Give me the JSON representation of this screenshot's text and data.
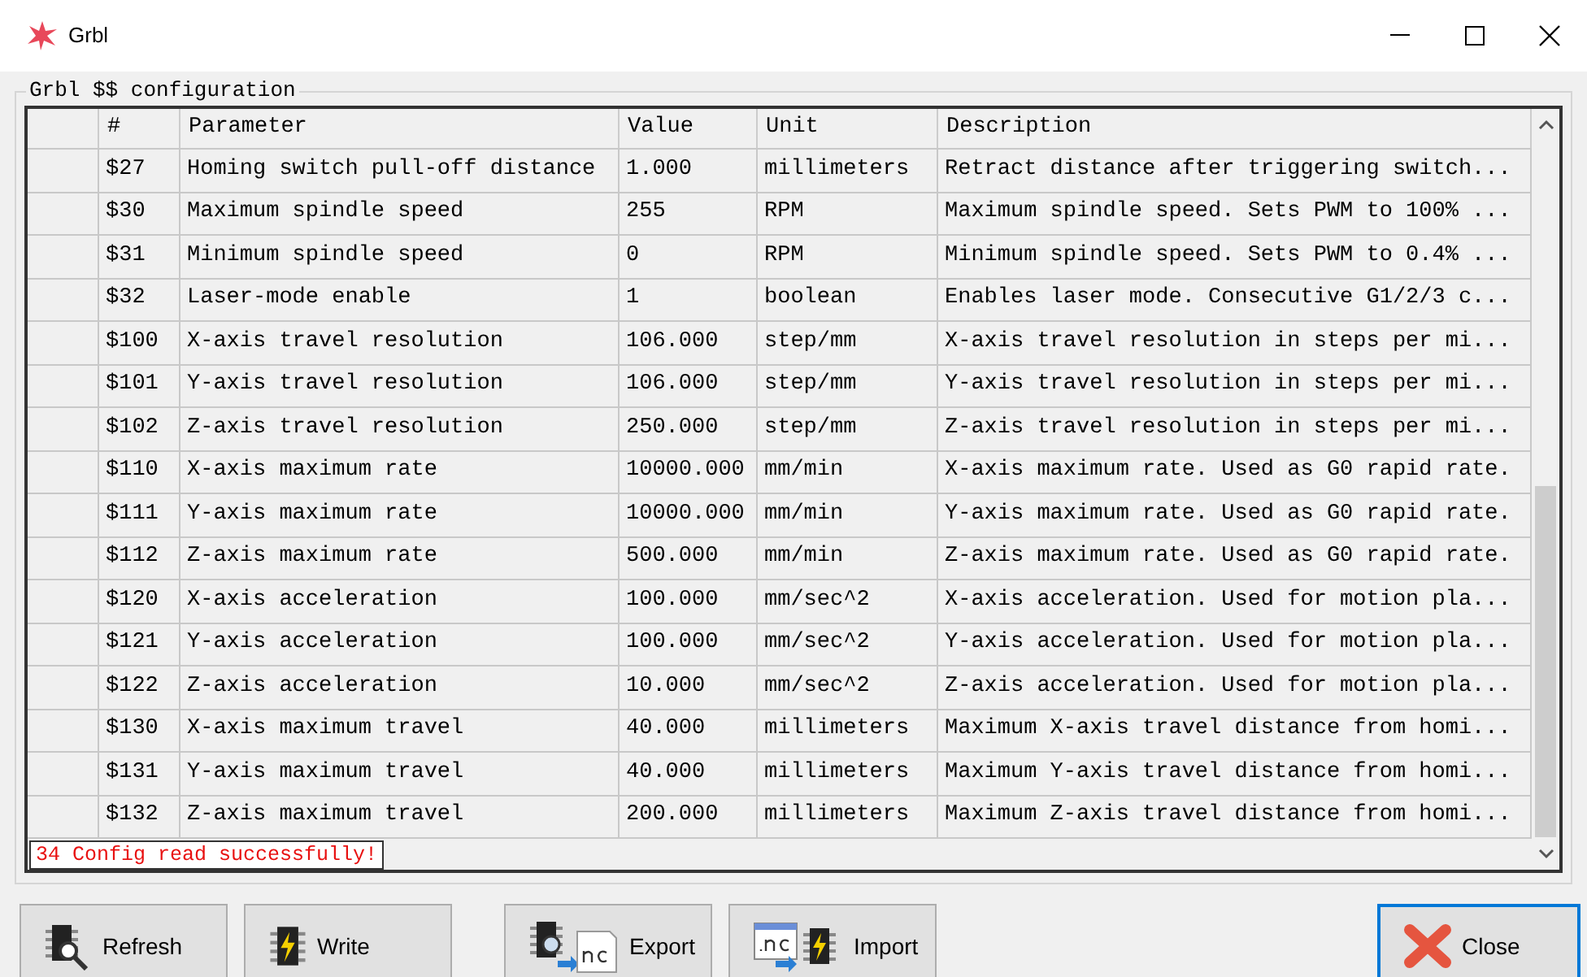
{
  "window": {
    "title": "Grbl"
  },
  "group": {
    "title": "Grbl $$ configuration"
  },
  "table": {
    "columns": [
      "#",
      "Parameter",
      "Value",
      "Unit",
      "Description"
    ],
    "rows": [
      {
        "cells": [
          "$27",
          "Homing switch pull-off distance",
          "1.000",
          "millimeters",
          "Retract distance after triggering switch..."
        ]
      },
      {
        "cells": [
          "$30",
          "Maximum spindle speed",
          "255",
          "RPM",
          "Maximum spindle speed. Sets PWM to 100% ..."
        ]
      },
      {
        "cells": [
          "$31",
          "Minimum spindle speed",
          "0",
          "RPM",
          "Minimum spindle speed. Sets PWM to 0.4% ..."
        ]
      },
      {
        "cells": [
          "$32",
          "Laser-mode enable",
          "1",
          "boolean",
          "Enables laser mode. Consecutive G1/2/3 c..."
        ]
      },
      {
        "cells": [
          "$100",
          "X-axis travel resolution",
          "106.000",
          "step/mm",
          "X-axis travel resolution in steps per mi..."
        ]
      },
      {
        "cells": [
          "$101",
          "Y-axis travel resolution",
          "106.000",
          "step/mm",
          "Y-axis travel resolution in steps per mi..."
        ]
      },
      {
        "cells": [
          "$102",
          "Z-axis travel resolution",
          "250.000",
          "step/mm",
          "Z-axis travel resolution in steps per mi..."
        ]
      },
      {
        "cells": [
          "$110",
          "X-axis maximum rate",
          "10000.000",
          "mm/min",
          "X-axis maximum rate. Used as G0 rapid rate."
        ]
      },
      {
        "cells": [
          "$111",
          "Y-axis maximum rate",
          "10000.000",
          "mm/min",
          "Y-axis maximum rate. Used as G0 rapid rate."
        ]
      },
      {
        "cells": [
          "$112",
          "Z-axis maximum rate",
          "500.000",
          "mm/min",
          "Z-axis maximum rate. Used as G0 rapid rate."
        ]
      },
      {
        "cells": [
          "$120",
          "X-axis acceleration",
          "100.000",
          "mm/sec^2",
          "X-axis acceleration. Used for motion pla..."
        ]
      },
      {
        "cells": [
          "$121",
          "Y-axis acceleration",
          "100.000",
          "mm/sec^2",
          "Y-axis acceleration. Used for motion pla..."
        ]
      },
      {
        "cells": [
          "$122",
          "Z-axis acceleration",
          "10.000",
          "mm/sec^2",
          "Z-axis acceleration. Used for motion pla..."
        ]
      },
      {
        "cells": [
          "$130",
          "X-axis maximum travel",
          "40.000",
          "millimeters",
          "Maximum X-axis travel distance from homi..."
        ]
      },
      {
        "cells": [
          "$131",
          "Y-axis maximum travel",
          "40.000",
          "millimeters",
          "Maximum Y-axis travel distance from homi..."
        ]
      },
      {
        "cells": [
          "$132",
          "Z-axis maximum travel",
          "200.000",
          "millimeters",
          "Maximum Z-axis travel distance from homi..."
        ]
      }
    ]
  },
  "status": {
    "text": "34 Config read successfully!"
  },
  "buttons": [
    {
      "label": "Refresh",
      "kind": "refresh",
      "focused": false
    },
    {
      "label": "Write",
      "kind": "write",
      "focused": false
    },
    {
      "label": "Export",
      "kind": "export",
      "focused": false
    },
    {
      "label": "Import",
      "kind": "import",
      "focused": false
    },
    {
      "label": "Close",
      "kind": "close",
      "focused": true
    }
  ]
}
